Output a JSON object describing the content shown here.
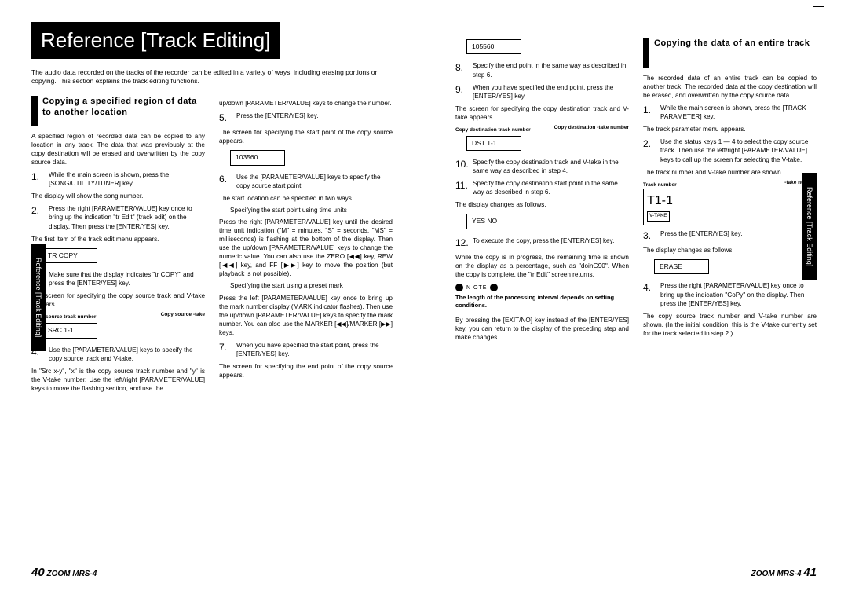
{
  "title": "Reference [Track Editing]",
  "side_tab": "Reference [Track Editing]",
  "intro": "The audio data recorded on the tracks of the recorder can be edited in a variety of ways, including erasing portions or copying. This section explains the track editing functions.",
  "section1_title": "Copying a specified region of data to another location",
  "section1_intro": "A specified region of recorded data can be copied to any location in any track. The data that was previously at the copy destination will be erased and overwritten by the copy source data.",
  "s1": "While the main screen is shown, press the [SONG/UTILITY/TUNER] key.",
  "s1_after": "The display will show the song number.",
  "s2": "Press the right [PARAMETER/VALUE] key once to bring up the indication \"tr Edit\" (track edit) on the display. Then press the [ENTER/YES] key.",
  "s2_after": "The first item of the track edit menu appears.",
  "disp_trcopy": "TR COPY",
  "s3": "Make sure that the display indicates \"tr COPY\" and press the [ENTER/YES] key.",
  "s3_after": "The screen for specifying the copy source track and V-take appears.",
  "diag1_l": "Copy source track number",
  "diag1_r": "Copy source -take",
  "disp_src": "SRC 1-1",
  "s4": "Use the [PARAMETER/VALUE] keys to specify the copy source track and V-take.",
  "s4_after": "In \"Src x-y\", \"x\" is the copy source track number and \"y\" is the V-take number. Use the left/right [PARAMETER/VALUE] keys to move the flashing section, and use the",
  "col2_top": "up/down [PARAMETER/VALUE] keys to change the number.",
  "s5": "Press the [ENTER/YES] key.",
  "s5_after": "The screen for specifying the start point of the copy source appears.",
  "disp_103560": "103560",
  "s6": "Use the [PARAMETER/VALUE] keys to specify the copy source start point.",
  "s6_after": "The start location can be specified in two ways.",
  "spec1_head": "Specifying the start point using time units",
  "spec1_body": "Press the right [PARAMETER/VALUE] key until the desired time unit indication (\"M\" = minutes, \"S\" = seconds, \"MS\" = milliseconds) is flashing at the bottom of the display. Then use the up/down [PARAMETER/VALUE] keys to change the numeric value. You can also use the ZERO [◀◀] key, REW [◀◀] key, and FF [▶▶] key to move the position (but playback is not possible).",
  "spec2_head": "Specifying the start using a preset mark",
  "spec2_body": "Press the left [PARAMETER/VALUE] key once to bring up the mark number display (MARK indicator flashes). Then use the up/down [PARAMETER/VALUE] keys to specify the mark number. You can also use the MARKER [◀◀]/MARKER [▶▶] keys.",
  "s7": "When you have specified the start point, press the [ENTER/YES] key.",
  "s7_after": "The screen for specifying the end point of the copy source appears.",
  "disp_105560": "105560",
  "s8": "Specify the end point in the same way as described in step 6.",
  "s9": "When you have specified the end point, press the [ENTER/YES] key.",
  "s9_after": "The screen for specifying the copy destination track and V-take appears.",
  "diag2_l": "Copy destination track number",
  "diag2_r": "Copy destination -take number",
  "disp_dst": "DST 1-1",
  "s10": "Specify the copy destination track and V-take in the same way as described in step 4.",
  "s11": "Specify the copy destination start point in the same way as described in step 6.",
  "s11_after": "The display changes as follows.",
  "disp_yesno": "YES NO",
  "s12": "To execute the copy, press the [ENTER/YES] key.",
  "s12_after": "While the copy is in progress, the remaining time is shown on the display as a percentage, such as \"doinG90\". When the copy is complete, the \"tr Edit\" screen returns.",
  "note_label": "N OTE",
  "note_text": "The length of the processing interval depends on setting conditions.",
  "exit_text": "By pressing the [EXIT/NO] key instead of the [ENTER/YES] key, you can return to the display of the preceding step and make changes.",
  "section2_title": "Copying the data of an entire track",
  "section2_intro": "The recorded data of an entire track can be copied to another track. The recorded data at the copy destination will be erased, and overwritten by the copy source data.",
  "r1": "While the main screen is shown, press the [TRACK PARAMETER] key.",
  "r1_after": "The track parameter menu appears.",
  "r2": "Use the status keys 1 — 4 to select the copy source track. Then use the left/right [PARAMETER/VALUE] keys to call up the screen for selecting the V-take.",
  "r2_after": "The track number and V-take number are shown.",
  "diag3_l": "Track number",
  "diag3_r": "-take number",
  "vtake_big": "T1-1",
  "vtake_small": "V-TAKE",
  "r3": "Press the [ENTER/YES] key.",
  "r3_after": "The display changes as follows.",
  "disp_erase": "ERASE",
  "r4": "Press the right [PARAMETER/VALUE] key once to bring up the indication \"CoPy\" on the display. Then press the [ENTER/YES] key.",
  "r4_after": "The copy source track number and V-take number are shown. (In the initial condition, this is the V-take currently set for the track selected in step 2.)",
  "footer_model": "ZOOM MRS-4",
  "page_left": "40",
  "page_right": "41"
}
